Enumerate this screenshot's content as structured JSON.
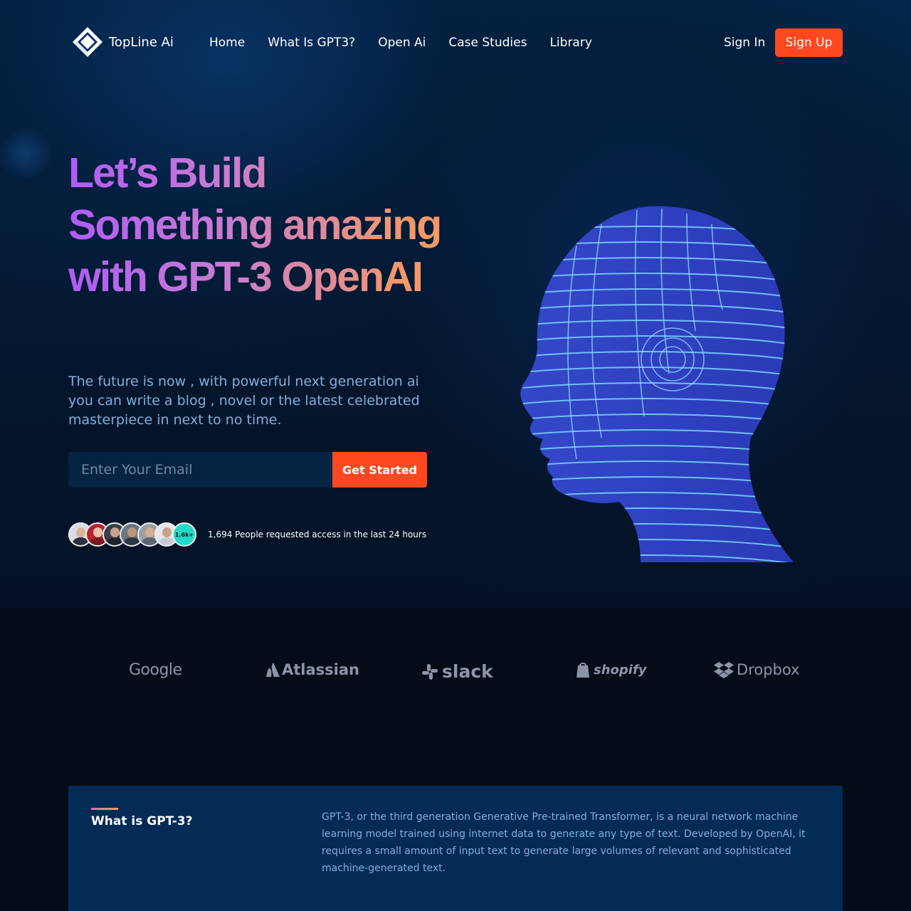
{
  "brand": {
    "name": "TopLine Ai",
    "logo_icon": "diamond-logo-icon"
  },
  "nav": {
    "items": [
      {
        "label": "Home"
      },
      {
        "label": "What Is GPT3?"
      },
      {
        "label": "Open Ai"
      },
      {
        "label": "Case Studies"
      },
      {
        "label": "Library"
      }
    ]
  },
  "auth": {
    "sign_in": "Sign In",
    "sign_up": "Sign Up"
  },
  "hero": {
    "headline": "Let’s Build Something amazing with GPT-3 OpenAI",
    "subtext": "The future is now , with powerful next generation ai you can write a blog , novel or the latest celebrated masterpiece in next to no time.",
    "email_placeholder": "Enter Your Email",
    "cta": "Get Started",
    "avatar_count_badge": "1.6k+",
    "access_text": "1,694 People requested access in the last 24 hours",
    "illustration": "wireframe-human-head"
  },
  "partners": [
    "Google",
    "Atlassian",
    "slack",
    "shopify",
    "Dropbox"
  ],
  "about": {
    "title": "What is GPT-3?",
    "body": "GPT-3, or the third generation Generative Pre-trained Transformer, is a neural network machine learning model trained using internet data to generate any type of text. Developed by OpenAI, it requires a small amount of input text to generate large volumes of relevant and sophisticated machine-generated text."
  },
  "colors": {
    "accent": "#ff4820",
    "gradient_start": "#af5cf7",
    "gradient_end": "#f49867",
    "subtext": "#81afdd",
    "card_bg": "#042b55",
    "brand_logo_gray": "#8a96a8"
  }
}
